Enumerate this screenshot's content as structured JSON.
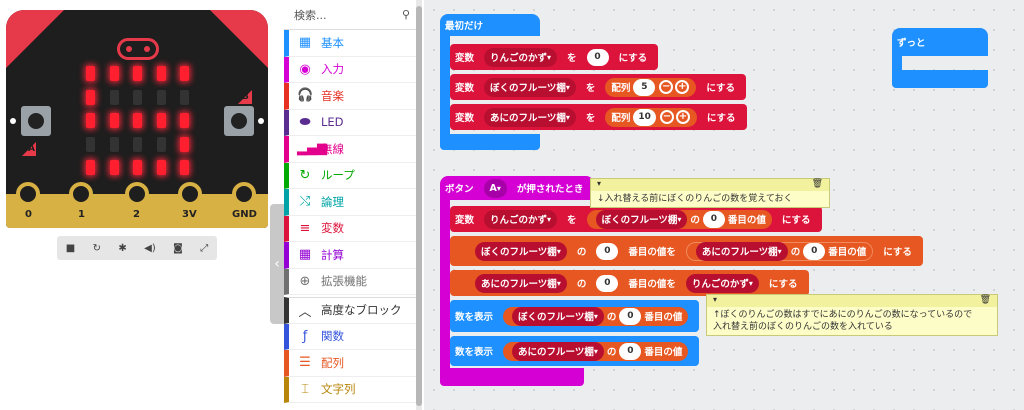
{
  "simulator": {
    "pins": [
      "0",
      "1",
      "2",
      "3V",
      "GND"
    ],
    "button_a": "A",
    "button_b": "B",
    "leds": [
      [
        1,
        1,
        1,
        1,
        1
      ],
      [
        1,
        0,
        0,
        0,
        0
      ],
      [
        1,
        1,
        1,
        1,
        1
      ],
      [
        0,
        0,
        0,
        0,
        1
      ],
      [
        1,
        1,
        1,
        1,
        1
      ]
    ],
    "toolbar": [
      "stop-icon",
      "restart-icon",
      "debug-icon",
      "mute-icon",
      "screenshot-icon",
      "fullscreen-icon"
    ]
  },
  "toolbox": {
    "search_placeholder": "検索...",
    "categories": [
      {
        "label": "基本",
        "color": "#1e90ff",
        "icon": "grid-icon"
      },
      {
        "label": "入力",
        "color": "#d400d4",
        "icon": "input-icon"
      },
      {
        "label": "音楽",
        "color": "#e63022",
        "icon": "headphones-icon"
      },
      {
        "label": "LED",
        "color": "#5c2d91",
        "icon": "toggle-icon"
      },
      {
        "label": "無線",
        "color": "#e3008c",
        "icon": "signal-icon"
      },
      {
        "label": "ループ",
        "color": "#00aa00",
        "icon": "loop-icon"
      },
      {
        "label": "論理",
        "color": "#00a4a6",
        "icon": "shuffle-icon"
      },
      {
        "label": "変数",
        "color": "#dc143c",
        "icon": "list-icon"
      },
      {
        "label": "計算",
        "color": "#9400d3",
        "icon": "calculator-icon"
      },
      {
        "label": "拡張機能",
        "color": "#707070",
        "icon": "plus-icon"
      },
      {
        "label": "高度なブロック",
        "color": "#333333",
        "icon": "chevron-up-icon"
      },
      {
        "label": "関数",
        "color": "#3455db",
        "icon": "function-icon"
      },
      {
        "label": "配列",
        "color": "#e65722",
        "icon": "array-icon"
      },
      {
        "label": "文字列",
        "color": "#b8860b",
        "icon": "text-icon"
      }
    ]
  },
  "workspace": {
    "on_start": {
      "hat": "最初だけ",
      "set1": {
        "kw": "変数",
        "var": "りんごのかず",
        "to": "を",
        "val": "0",
        "end": "にする"
      },
      "set2": {
        "kw": "変数",
        "var": "ぼくのフルーツ棚",
        "to": "を",
        "arr": "配列",
        "val": "5",
        "end": "にする"
      },
      "set3": {
        "kw": "変数",
        "var": "あにのフルーツ棚",
        "to": "を",
        "arr": "配列",
        "val": "10",
        "end": "にする"
      }
    },
    "forever": {
      "hat": "ずっと"
    },
    "button_event": {
      "hat_prefix": "ボタン",
      "button": "A",
      "hat_suffix": "が押されたとき",
      "row1": {
        "kw": "変数",
        "var": "りんごのかず",
        "to": "を",
        "arr": "ぼくのフルーツ棚",
        "of": "の",
        "idx": "0",
        "nth": "番目の値",
        "end": "にする"
      },
      "row2": {
        "arr": "ぼくのフルーツ棚",
        "of": "の",
        "idx": "0",
        "nth": "番目の値を",
        "arr2": "あにのフルーツ棚",
        "of2": "の",
        "idx2": "0",
        "nth2": "番目の値",
        "end": "にする"
      },
      "row3": {
        "arr": "あにのフルーツ棚",
        "of": "の",
        "idx": "0",
        "nth": "番目の値を",
        "var": "りんごのかず",
        "end": "にする"
      },
      "row4": {
        "kw": "数を表示",
        "arr": "ぼくのフルーツ棚",
        "of": "の",
        "idx": "0",
        "nth": "番目の値"
      },
      "row5": {
        "kw": "数を表示",
        "arr": "あにのフルーツ棚",
        "of": "の",
        "idx": "0",
        "nth": "番目の値"
      }
    },
    "comment1": "↓入れ替える前にぼくのりんごの数を覚えておく",
    "comment2_line1": "↑ぼくのりんごの数はすでにあにのりんごの数になっているので",
    "comment2_line2": "入れ替え前のぼくのりんごの数を入れている"
  }
}
